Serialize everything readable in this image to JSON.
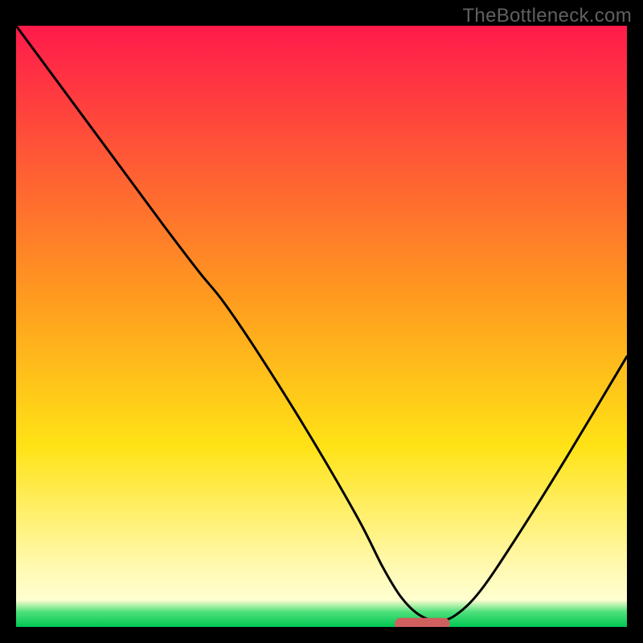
{
  "watermark": "TheBottleneck.com",
  "chart_data": {
    "type": "line",
    "title": "",
    "xlabel": "",
    "ylabel": "",
    "x_range": [
      0,
      100
    ],
    "y_range": [
      0,
      100
    ],
    "gradient_stops": [
      {
        "offset": 0.0,
        "color": "#ff1a4b"
      },
      {
        "offset": 0.45,
        "color": "#ff9a1f"
      },
      {
        "offset": 0.7,
        "color": "#ffe316"
      },
      {
        "offset": 0.9,
        "color": "#fff9b0"
      },
      {
        "offset": 0.955,
        "color": "#ffffd0"
      },
      {
        "offset": 0.975,
        "color": "#4fe07a"
      },
      {
        "offset": 1.0,
        "color": "#00c853"
      }
    ],
    "curve": {
      "name": "bottleneck-curve",
      "x": [
        0,
        8,
        16,
        24,
        30,
        34,
        40,
        48,
        56,
        60,
        63,
        66,
        69,
        72,
        76,
        82,
        90,
        100
      ],
      "y": [
        100,
        89,
        78,
        67,
        59,
        54,
        45,
        32,
        18,
        10,
        5,
        2,
        1,
        2,
        6,
        15,
        28,
        45
      ]
    },
    "marker": {
      "x_start": 62,
      "x_end": 71,
      "y": 0.5,
      "color": "#d0605e",
      "thickness": 2.0
    }
  }
}
